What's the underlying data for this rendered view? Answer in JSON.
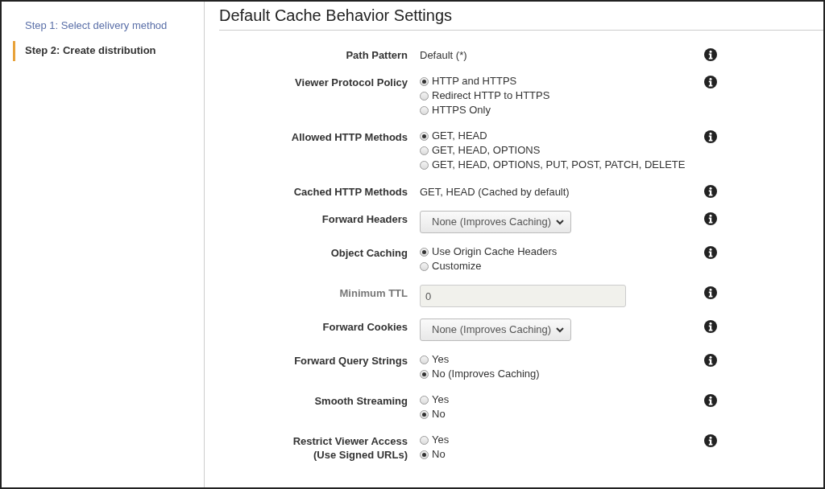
{
  "sidebar": {
    "steps": [
      {
        "label": "Step 1: Select delivery method",
        "selected": false
      },
      {
        "label": "Step 2: Create distribution",
        "selected": true
      }
    ]
  },
  "section": {
    "title": "Default Cache Behavior Settings",
    "rows": [
      {
        "kind": "text",
        "label": "Path Pattern",
        "value": "Default (*)"
      },
      {
        "kind": "radio",
        "label": "Viewer Protocol Policy",
        "options": [
          {
            "label": "HTTP and HTTPS",
            "selected": true
          },
          {
            "label": "Redirect HTTP to HTTPS",
            "selected": false
          },
          {
            "label": "HTTPS Only",
            "selected": false
          }
        ]
      },
      {
        "kind": "radio",
        "label": "Allowed HTTP Methods",
        "options": [
          {
            "label": "GET, HEAD",
            "selected": true
          },
          {
            "label": "GET, HEAD, OPTIONS",
            "selected": false
          },
          {
            "label": "GET, HEAD, OPTIONS, PUT, POST, PATCH, DELETE",
            "selected": false
          }
        ]
      },
      {
        "kind": "text",
        "label": "Cached HTTP Methods",
        "value": "GET, HEAD (Cached by default)"
      },
      {
        "kind": "select",
        "label": "Forward Headers",
        "value": "None (Improves Caching)"
      },
      {
        "kind": "radio",
        "label": "Object Caching",
        "options": [
          {
            "label": "Use Origin Cache Headers",
            "selected": true
          },
          {
            "label": "Customize",
            "selected": false
          }
        ]
      },
      {
        "kind": "input",
        "label": "Minimum TTL",
        "value": "0",
        "disabled": true
      },
      {
        "kind": "select",
        "label": "Forward Cookies",
        "value": "None (Improves Caching)"
      },
      {
        "kind": "radio",
        "label": "Forward Query Strings",
        "options": [
          {
            "label": "Yes",
            "selected": false
          },
          {
            "label": "No (Improves Caching)",
            "selected": true
          }
        ]
      },
      {
        "kind": "radio",
        "label": "Smooth Streaming",
        "options": [
          {
            "label": "Yes",
            "selected": false
          },
          {
            "label": "No",
            "selected": true
          }
        ]
      },
      {
        "kind": "radio",
        "label": "Restrict Viewer Access",
        "label_note": "(Use Signed URLs)",
        "options": [
          {
            "label": "Yes",
            "selected": false
          },
          {
            "label": "No",
            "selected": true
          }
        ]
      }
    ]
  }
}
